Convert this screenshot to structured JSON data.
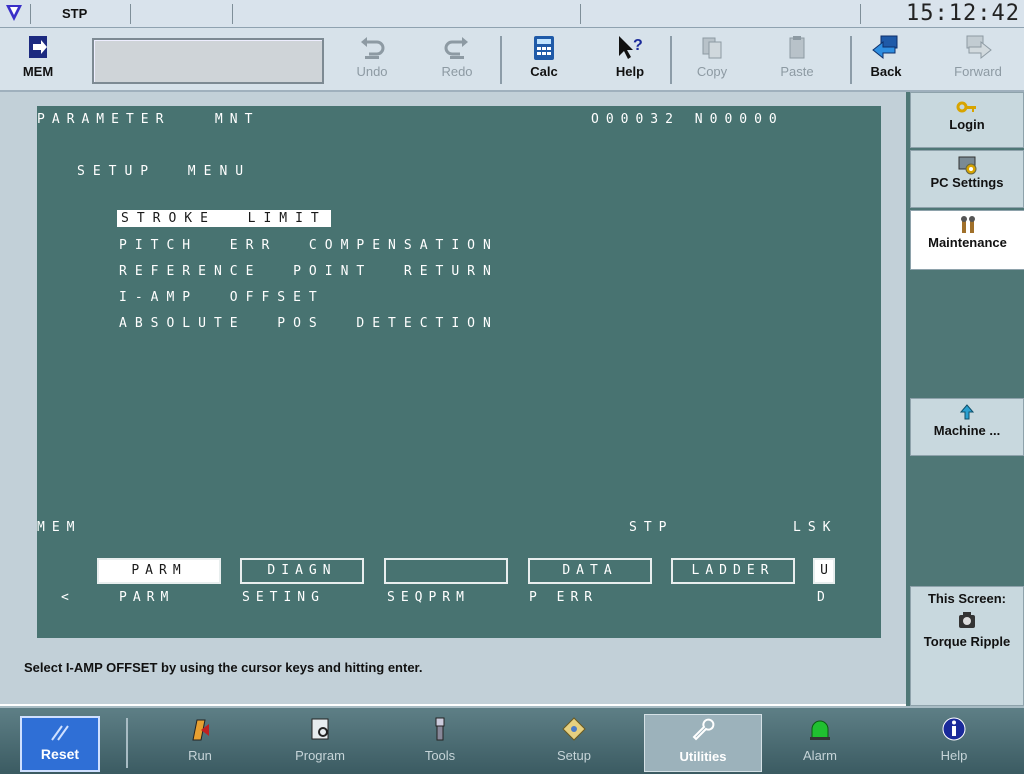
{
  "topbar": {
    "mode": "STP",
    "clock": "15:12:42"
  },
  "toolbar": {
    "mem": "MEM",
    "undo": "Undo",
    "redo": "Redo",
    "calc": "Calc",
    "help": "Help",
    "copy": "Copy",
    "paste": "Paste",
    "back": "Back",
    "forward": "Forward"
  },
  "cnc": {
    "header_left": "PARAMETER   MNT",
    "header_right": "O00032 N00000",
    "menu_title": "SETUP  MENU",
    "menu_items": [
      "STROKE  LIMIT",
      "PITCH  ERR  COMPENSATION",
      "REFERENCE  POINT  RETURN",
      "I-AMP  OFFSET",
      "ABSOLUTE  POS  DETECTION"
    ],
    "status_left": "MEM",
    "status_mid": "STP",
    "status_right": "LSK",
    "softkeys": [
      "PARM",
      "DIAGN",
      "",
      "DATA",
      "LADDER"
    ],
    "softkey_end": "U",
    "softkey_labels": [
      "PARM",
      "SETING",
      "SEQPRM",
      "P ERR"
    ],
    "prev": "<",
    "end_label": "D"
  },
  "status_message": "Select I-AMP OFFSET by using the cursor keys and hitting enter.",
  "sidebar": {
    "login": "Login",
    "pc_settings": "PC Settings",
    "maintenance": "Maintenance",
    "machine": "Machine ...",
    "this_screen": "This Screen:",
    "screen_name": "Torque Ripple"
  },
  "taskbar": {
    "reset": "Reset",
    "run": "Run",
    "program": "Program",
    "tools": "Tools",
    "setup": "Setup",
    "utilities": "Utilities",
    "alarm": "Alarm",
    "help": "Help"
  }
}
